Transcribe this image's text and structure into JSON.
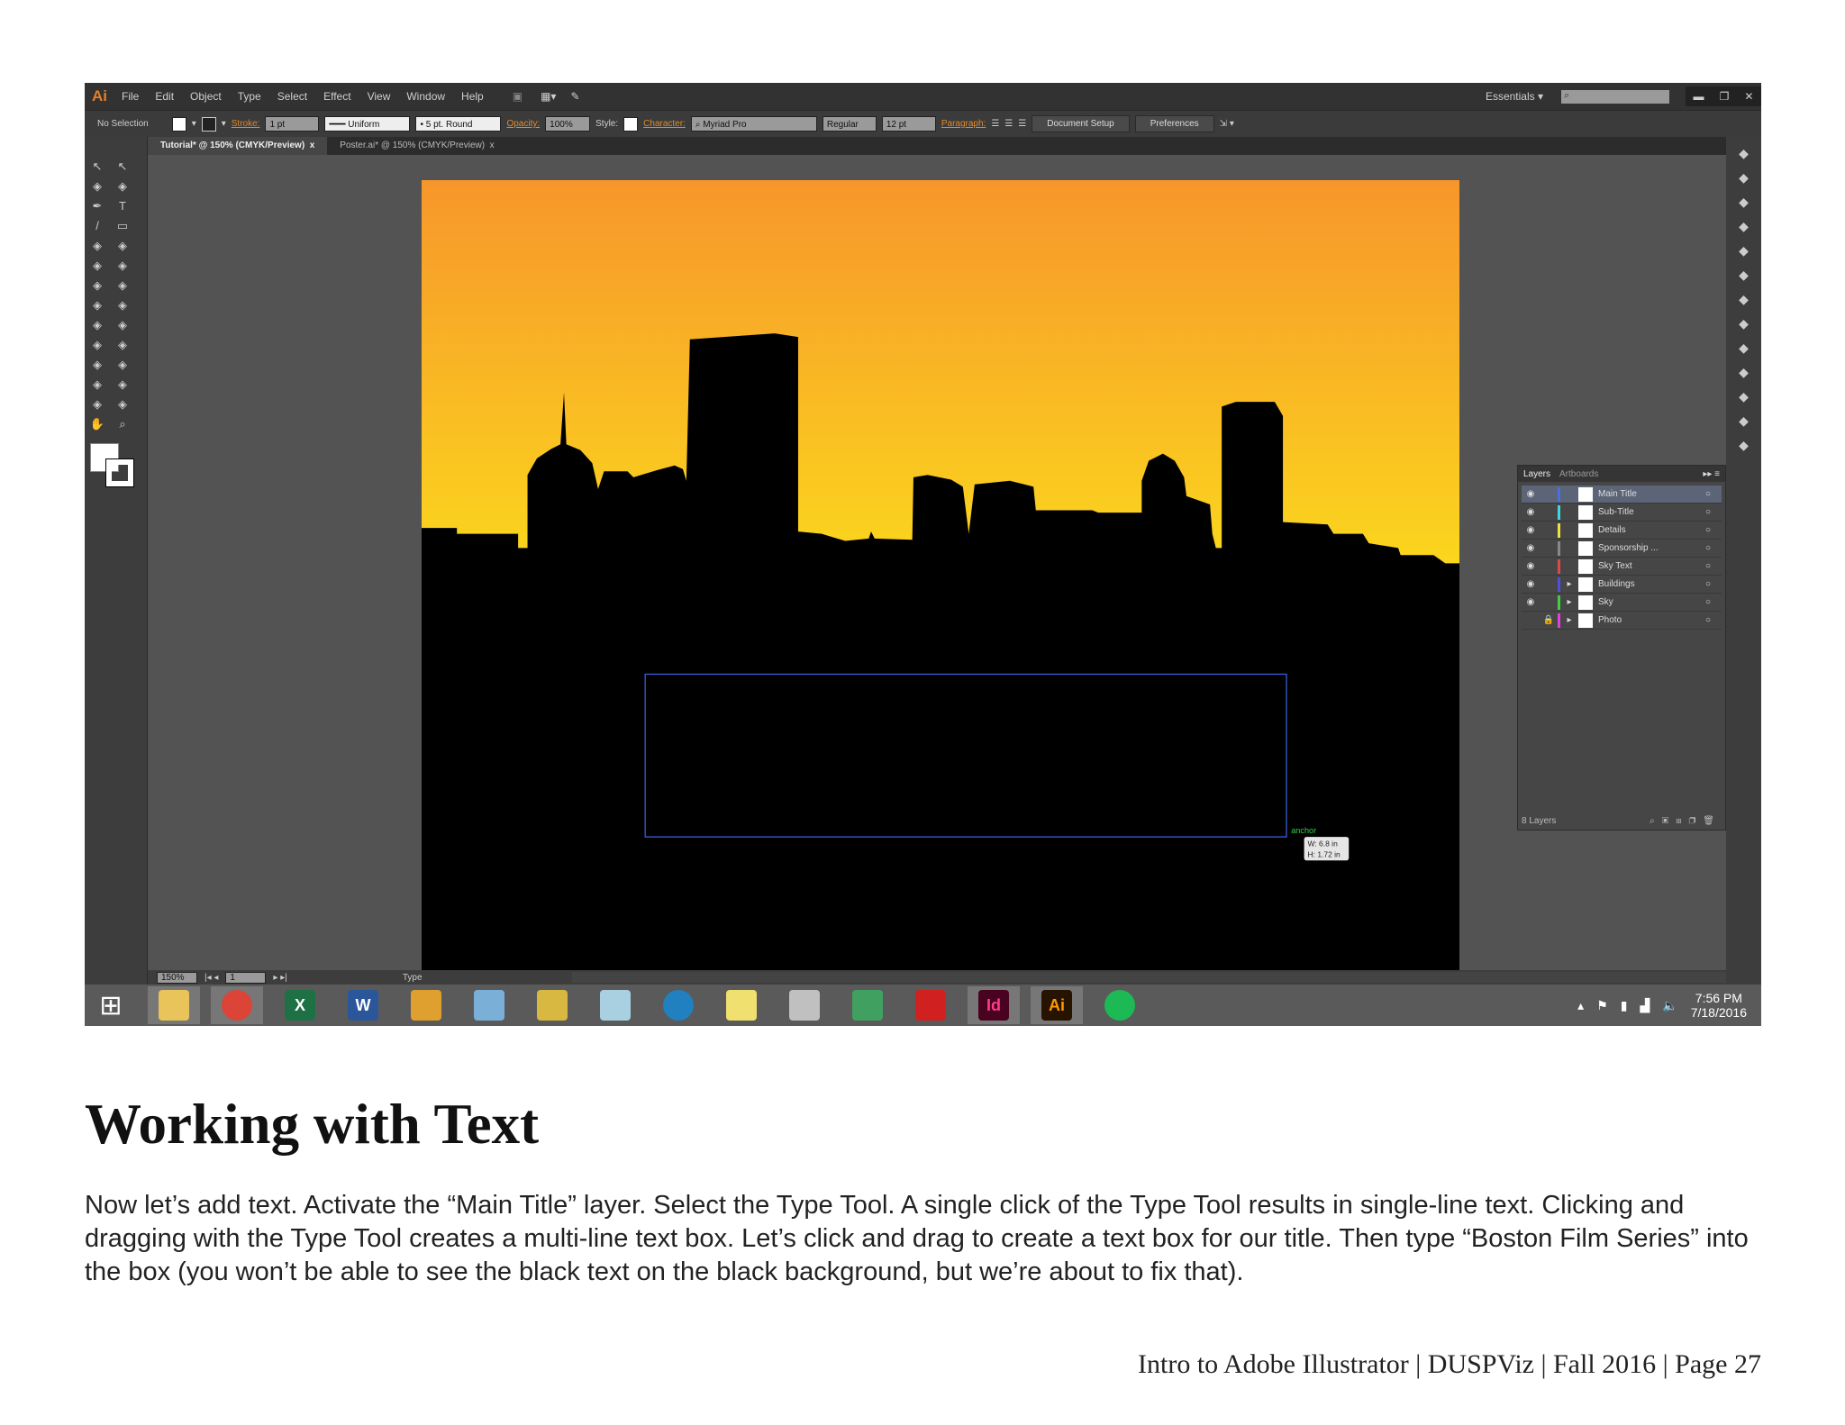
{
  "app": {
    "logo": "Ai",
    "menu": [
      "File",
      "Edit",
      "Object",
      "Type",
      "Select",
      "Effect",
      "View",
      "Window",
      "Help"
    ],
    "workspace": "Essentials",
    "window_controls": [
      "minimize",
      "restore",
      "close"
    ]
  },
  "control": {
    "selection": "No Selection",
    "stroke_label": "Stroke:",
    "stroke_weight": "1 pt",
    "profile": "Uniform",
    "brush": "5 pt. Round",
    "opacity_label": "Opacity:",
    "opacity": "100%",
    "style_label": "Style:",
    "character_label": "Character:",
    "font": "Myriad Pro",
    "font_style": "Regular",
    "font_size": "12 pt",
    "paragraph_label": "Paragraph:",
    "document_setup": "Document Setup",
    "preferences": "Preferences"
  },
  "tabs": [
    {
      "label": "Tutorial* @ 150% (CMYK/Preview)",
      "close": "x"
    },
    {
      "label": "Poster.ai* @ 150% (CMYK/Preview)",
      "close": "x"
    }
  ],
  "canvas": {
    "sky_top": "#f7962b",
    "sky_bottom": "#fbd81d",
    "smart_guide": "anchor",
    "size_w": "W: 6.8 in",
    "size_h": "H: 1.72 in"
  },
  "layers_panel": {
    "tabs": [
      "Layers",
      "Artboards"
    ],
    "layers": [
      {
        "name": "Main Title",
        "color": "#4a6fe0",
        "visible": true,
        "locked": false,
        "expandable": false
      },
      {
        "name": "Sub-Title",
        "color": "#3fd7e0",
        "visible": true,
        "locked": false,
        "expandable": false
      },
      {
        "name": "Details",
        "color": "#f0e040",
        "visible": true,
        "locked": false,
        "expandable": false
      },
      {
        "name": "Sponsorship ...",
        "color": "#888888",
        "visible": true,
        "locked": false,
        "expandable": false
      },
      {
        "name": "Sky Text",
        "color": "#e04848",
        "visible": true,
        "locked": false,
        "expandable": false
      },
      {
        "name": "Buildings",
        "color": "#5050e0",
        "visible": true,
        "locked": false,
        "expandable": true
      },
      {
        "name": "Sky",
        "color": "#40d040",
        "visible": true,
        "locked": false,
        "expandable": true
      },
      {
        "name": "Photo",
        "color": "#e040e0",
        "visible": false,
        "locked": true,
        "expandable": true
      }
    ],
    "count": "8 Layers"
  },
  "status": {
    "zoom": "150%",
    "artboard": "1",
    "tool": "Type"
  },
  "taskbar": {
    "apps": [
      {
        "name": "file-explorer",
        "label": "",
        "color": "#e8c45a"
      },
      {
        "name": "chrome",
        "label": "",
        "color": "#db4437"
      },
      {
        "name": "excel",
        "label": "X",
        "color": "#1e7145"
      },
      {
        "name": "word",
        "label": "W",
        "color": "#2b579a"
      },
      {
        "name": "snipping",
        "label": "",
        "color": "#e0a030"
      },
      {
        "name": "calculator",
        "label": "",
        "color": "#7ab0d8"
      },
      {
        "name": "file-cabinet",
        "label": "",
        "color": "#d8b840"
      },
      {
        "name": "notepad",
        "label": "",
        "color": "#a8d0e0"
      },
      {
        "name": "search-app",
        "label": "",
        "color": "#2080c0"
      },
      {
        "name": "sticky-notes",
        "label": "",
        "color": "#f0e070"
      },
      {
        "name": "paint",
        "label": "",
        "color": "#c0c0c0"
      },
      {
        "name": "sync",
        "label": "",
        "color": "#40a060"
      },
      {
        "name": "acrobat",
        "label": "",
        "color": "#d02020"
      },
      {
        "name": "indesign",
        "label": "Id",
        "color": "#49021f"
      },
      {
        "name": "illustrator",
        "label": "Ai",
        "color": "#261300"
      },
      {
        "name": "spotify",
        "label": "",
        "color": "#1db954"
      }
    ],
    "time": "7:56 PM",
    "date": "7/18/2016"
  },
  "doc": {
    "heading": "Working with Text",
    "body": "Now let’s add text. Activate the “Main Title” layer. Select the Type Tool. A single click of the Type Tool results in single-line text. Clicking and dragging with the Type Tool creates a multi-line text box. Let’s click and drag to create a text box for our title. Then type “Boston Film Series” into the box (you won’t be able to see the black text on the black background, but we’re about to fix that).",
    "footer": "Intro to Adobe Illustrator | DUSPViz | Fall 2016 | Page 27"
  }
}
